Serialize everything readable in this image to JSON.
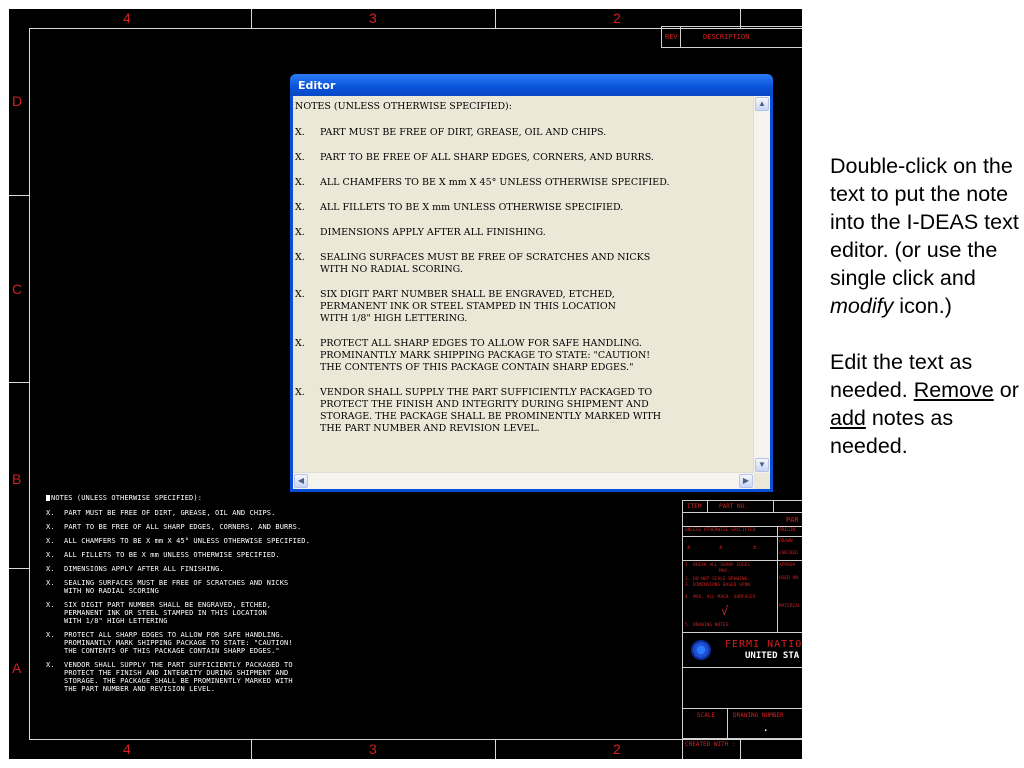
{
  "drawing": {
    "zones_top": [
      "4",
      "3",
      "2"
    ],
    "zones_bottom": [
      "4",
      "3",
      "2"
    ],
    "zones_side": [
      "D",
      "C",
      "B",
      "A"
    ],
    "revision_block": {
      "rev": "REV",
      "description": "DESCRIPTION"
    },
    "notes": {
      "title": "NOTES (UNLESS OTHERWISE SPECIFIED):",
      "items": [
        {
          "mark": "X.",
          "text": "PART MUST BE FREE OF DIRT, GREASE, OIL AND CHIPS."
        },
        {
          "mark": "X.",
          "text": "PART TO BE FREE OF ALL SHARP EDGES, CORNERS, AND BURRS."
        },
        {
          "mark": "X.",
          "text": "ALL CHAMFERS TO BE X mm X 45° UNLESS OTHERWISE SPECIFIED."
        },
        {
          "mark": "X.",
          "text": "ALL FILLETS TO BE X mm UNLESS OTHERWISE SPECIFIED."
        },
        {
          "mark": "X.",
          "text": "DIMENSIONS APPLY AFTER ALL FINISHING."
        },
        {
          "mark": "X.",
          "text": "SEALING SURFACES MUST BE FREE OF SCRATCHES AND NICKS\nWITH NO RADIAL SCORING"
        },
        {
          "mark": "X.",
          "text": "SIX DIGIT PART NUMBER SHALL BE ENGRAVED, ETCHED,\nPERMANENT INK OR STEEL STAMPED IN THIS LOCATION\nWITH 1/8\" HIGH LETTERING"
        },
        {
          "mark": "X.",
          "text": "PROTECT ALL SHARP EDGES TO ALLOW FOR SAFE HANDLING.\nPROMINANTLY MARK SHIPPING PACKAGE TO STATE: \"CAUTION!\nTHE CONTENTS OF THIS PACKAGE CONTAIN SHARP EDGES.\""
        },
        {
          "mark": "X.",
          "text": "VENDOR SHALL SUPPLY THE PART SUFFICIENTLY PACKAGED TO\nPROTECT THE FINISH AND INTEGRITY DURING SHIPMENT AND\nSTORAGE. THE PACKAGE SHALL BE PROMINENTLY MARKED WITH\nTHE PART NUMBER AND REVISION LEVEL."
        }
      ]
    },
    "title_block": {
      "item": "ITEM",
      "part_no": "PART NO.",
      "par": "PAR",
      "unless": "UNLESS OTHERWISE SPECIFIED",
      "orig": "ORIGIN",
      "drawn": "DRAWN",
      "checked": "CHECKED",
      "approved": "APPROV",
      "used_on": "USED ON",
      "material": "MATERIAL",
      "break_edges": "1. BREAK ALL SHARP EDGES",
      "break_edges_2": "MAX.",
      "do_not_scale": "2. DO NOT SCALE DRAWING.",
      "dimensions": "3. DIMENSIONS BASED UPON",
      "machined": "4. MAX. ALL MACH. SURFACES",
      "drawing_notes": "5. DRAWING NOTES:",
      "lab_name": "FERMI NATIONA",
      "lab_country": "UNITED STA",
      "scale": "SCALE",
      "drawing_number": "DRAWING NUMBER",
      "created_with": "CREATED WITH :",
      "fraction_1": "±",
      "fraction_2": "±",
      "fraction_3": "±",
      "check_mark": "√",
      "dot": "."
    }
  },
  "editor": {
    "title": "Editor",
    "notes": {
      "title": "NOTES (UNLESS OTHERWISE SPECIFIED):",
      "items": [
        {
          "mark": "X.",
          "text": "PART MUST BE FREE OF DIRT, GREASE, OIL AND CHIPS."
        },
        {
          "mark": "X.",
          "text": "PART TO BE FREE OF ALL SHARP EDGES, CORNERS, AND BURRS."
        },
        {
          "mark": "X.",
          "text": "ALL CHAMFERS TO BE X mm X 45° UNLESS OTHERWISE SPECIFIED."
        },
        {
          "mark": "X.",
          "text": "ALL FILLETS TO BE X mm UNLESS OTHERWISE SPECIFIED."
        },
        {
          "mark": "X.",
          "text": "DIMENSIONS APPLY AFTER ALL FINISHING."
        },
        {
          "mark": "X.",
          "text": "SEALING SURFACES MUST BE FREE OF SCRATCHES AND NICKS\nWITH NO RADIAL SCORING."
        },
        {
          "mark": "X.",
          "text": "SIX DIGIT PART NUMBER SHALL BE ENGRAVED, ETCHED,\nPERMANENT INK OR STEEL STAMPED IN THIS LOCATION\nWITH 1/8\" HIGH LETTERING."
        },
        {
          "mark": "X.",
          "text": "PROTECT ALL SHARP EDGES TO ALLOW FOR SAFE HANDLING.\nPROMINANTLY MARK SHIPPING PACKAGE TO STATE: \"CAUTION!\nTHE CONTENTS OF THIS PACKAGE CONTAIN SHARP EDGES.\""
        },
        {
          "mark": "X.",
          "text": "VENDOR SHALL SUPPLY THE PART SUFFICIENTLY PACKAGED TO\nPROTECT THE FINISH AND INTEGRITY DURING SHIPMENT AND\nSTORAGE. THE PACKAGE SHALL BE PROMINENTLY MARKED WITH\nTHE PART NUMBER AND REVISION LEVEL."
        }
      ]
    },
    "scroll_up": "▲",
    "scroll_down": "▼",
    "scroll_left": "◀",
    "scroll_right": "▶"
  },
  "annotation": {
    "para1": "Double-click on the text to put the note into the I-DEAS text editor. (or use the single click and ",
    "para1_em": "modify",
    "para1_end": " icon.)",
    "para2_start": "Edit the text as needed. ",
    "remove": "Remove",
    "or": " or ",
    "add": "add",
    "para2_end": " notes as needed."
  },
  "colors": {
    "zone_label": "#d22020",
    "titlebar": "#0a53d8",
    "editor_background": "#ece8d8"
  }
}
